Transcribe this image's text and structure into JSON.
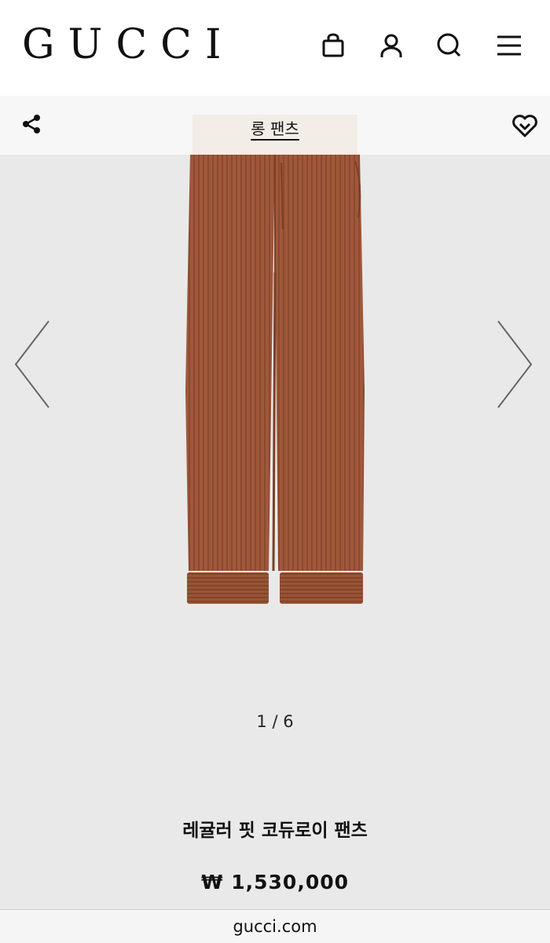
{
  "brand": {
    "logo_text": "GUCCI"
  },
  "header": {
    "icons": [
      "shopping-bag-icon",
      "user-icon",
      "search-icon",
      "menu-icon"
    ]
  },
  "subbar": {
    "category_label": "롱 팬츠",
    "share_icon": "share-icon",
    "wishlist_icon": "heart-icon"
  },
  "gallery": {
    "counter": "1 / 6",
    "current_index": 1,
    "total": 6,
    "prev_icon": "chevron-left-icon",
    "next_icon": "chevron-right-icon"
  },
  "product": {
    "name": "레귤러 핏 코듀로이 팬츠",
    "price": "₩ 1,530,000",
    "color": "#a0583a"
  },
  "browser": {
    "url": "gucci.com"
  }
}
